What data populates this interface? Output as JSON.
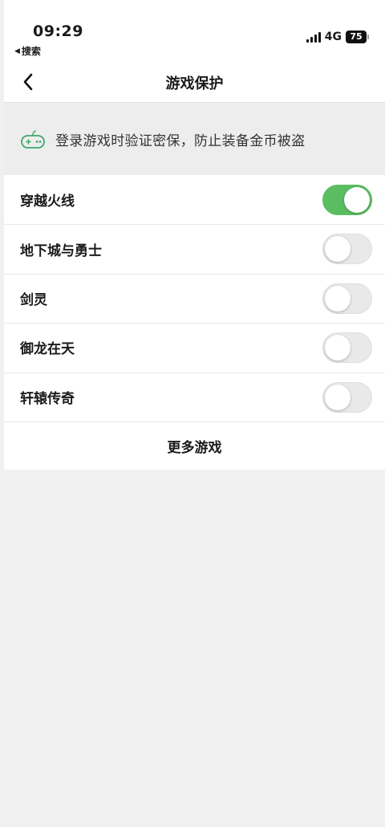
{
  "status_bar": {
    "time": "09:29",
    "back_app_label": "搜索",
    "network": "4G",
    "battery": "75"
  },
  "nav": {
    "title": "游戏保护",
    "back_icon": "chevron-left-icon"
  },
  "banner": {
    "icon": "gamepad-icon",
    "text": "登录游戏时验证密保，防止装备金币被盗"
  },
  "games": [
    {
      "name": "穿越火线",
      "enabled": true
    },
    {
      "name": "地下城与勇士",
      "enabled": false
    },
    {
      "name": "剑灵",
      "enabled": false
    },
    {
      "name": "御龙在天",
      "enabled": false
    },
    {
      "name": "轩辕传奇",
      "enabled": false
    }
  ],
  "more_label": "更多游戏",
  "colors": {
    "toggle_on": "#5bbd62",
    "icon_accent": "#3fa86e"
  }
}
